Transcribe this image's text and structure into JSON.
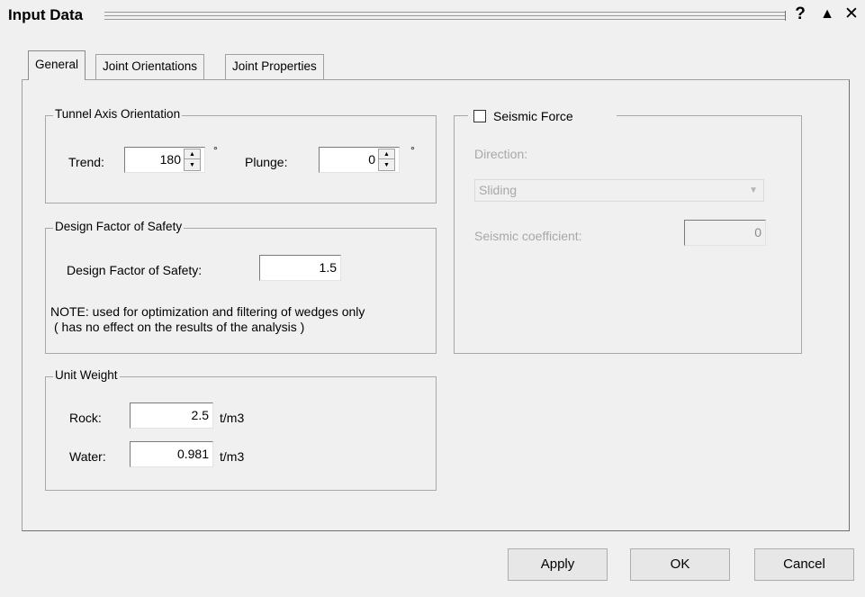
{
  "window": {
    "title": "Input Data",
    "help_glyph": "?",
    "collapse_glyph": "▲",
    "close_glyph": "✕"
  },
  "tabs": [
    {
      "label": "General",
      "active": true
    },
    {
      "label": "Joint Orientations",
      "active": false
    },
    {
      "label": "Joint Properties",
      "active": false
    }
  ],
  "tunnel_axis": {
    "group_label": "Tunnel Axis Orientation",
    "trend_label": "Trend:",
    "trend_value": "180",
    "plunge_label": "Plunge:",
    "plunge_value": "0",
    "degree_symbol": "°"
  },
  "design_fos": {
    "group_label": "Design Factor of Safety",
    "field_label": "Design Factor of Safety:",
    "value": "1.5",
    "note_line1": "NOTE: used for optimization and filtering of wedges only",
    "note_line2": "( has no effect on the results of the analysis )"
  },
  "unit_weight": {
    "group_label": "Unit Weight",
    "rock_label": "Rock:",
    "rock_value": "2.5",
    "water_label": "Water:",
    "water_value": "0.981",
    "unit": "t/m3"
  },
  "seismic": {
    "checkbox_label": "Seismic Force",
    "checked": false,
    "direction_label": "Direction:",
    "direction_value": "Sliding",
    "coefficient_label": "Seismic coefficient:",
    "coefficient_value": "0"
  },
  "buttons": {
    "apply": "Apply",
    "ok": "OK",
    "cancel": "Cancel"
  },
  "icons": {
    "spinner_up": "▲",
    "spinner_down": "▼",
    "dropdown": "▼"
  },
  "colors": {
    "background": "#f0f0f0",
    "disabled_text": "#a8a8a8",
    "group_border": "#a8a8a8"
  }
}
